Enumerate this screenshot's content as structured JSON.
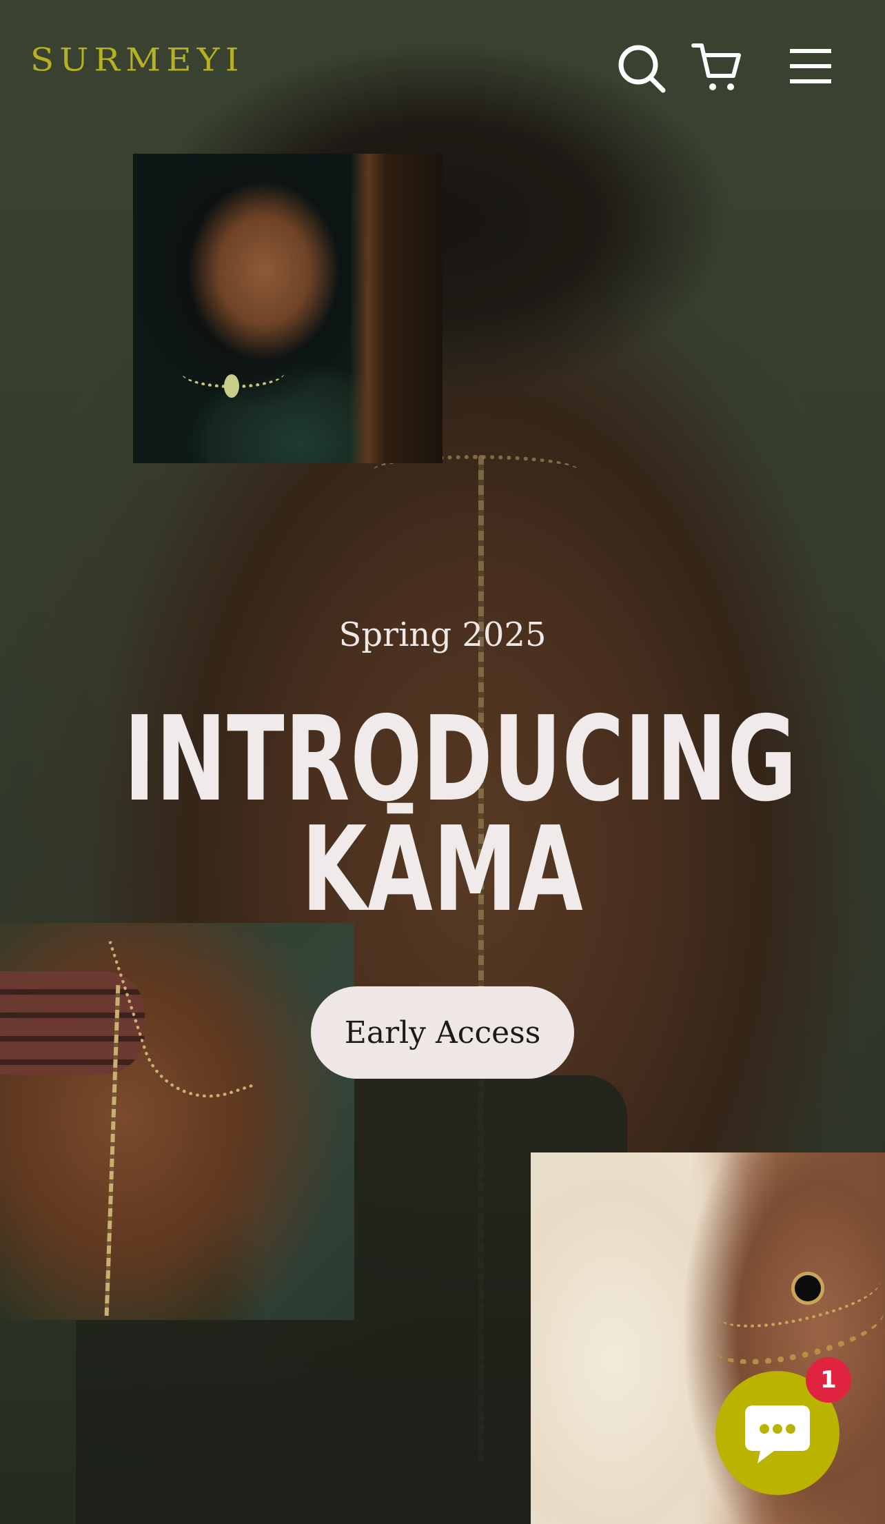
{
  "header": {
    "logo_text": "SURMEYI",
    "icons": [
      "search-icon",
      "cart-icon",
      "menu-icon"
    ]
  },
  "hero": {
    "eyebrow": "Spring 2025",
    "headline_line1": "INTRODUCING",
    "headline_line2": "KĀMA",
    "cta_label": "Early Access"
  },
  "chat": {
    "icon": "chat-icon",
    "badge_count": "1"
  },
  "colors": {
    "brand": "#b7b021",
    "chat_button": "#bab300",
    "badge": "#e0243f",
    "cta_background": "#eee7e6",
    "headline_text": "#f1eaea"
  }
}
